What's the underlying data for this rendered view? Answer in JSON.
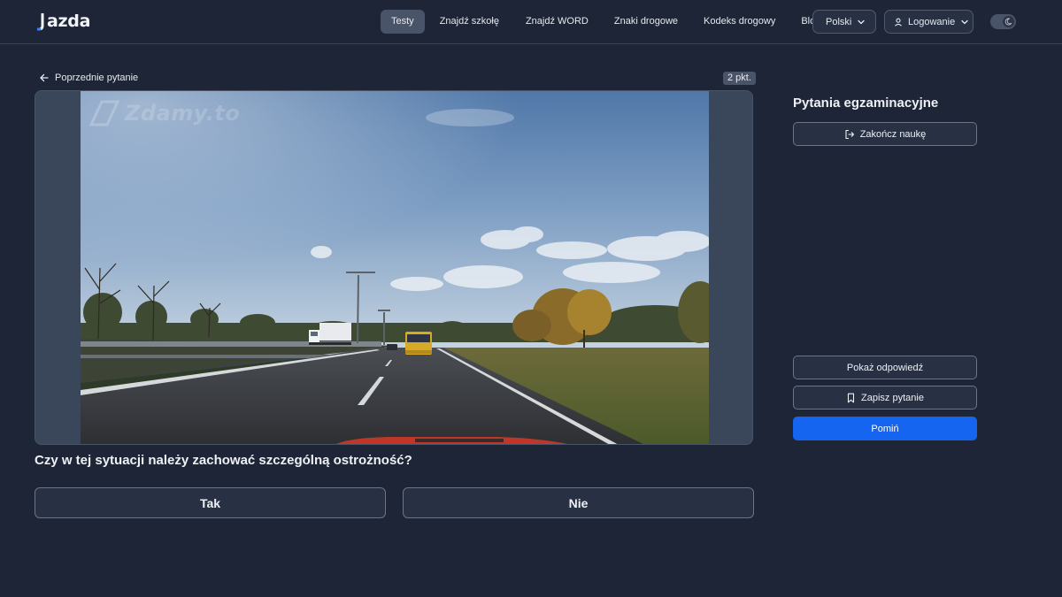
{
  "header": {
    "logo_text": "azda",
    "nav": [
      {
        "label": "Testy",
        "active": true
      },
      {
        "label": "Znajdź szkołę",
        "active": false
      },
      {
        "label": "Znajdź WORD",
        "active": false
      },
      {
        "label": "Znaki drogowe",
        "active": false
      },
      {
        "label": "Kodeks drogowy",
        "active": false
      },
      {
        "label": "Blog",
        "active": false
      }
    ],
    "language_label": "Polski",
    "login_label": "Logowanie",
    "theme_toggle_icon": "moon-icon"
  },
  "question": {
    "prev_label": "Poprzednie pytanie",
    "points_label": "2 pkt.",
    "media_watermark": "Zdamy.to",
    "text": "Czy w tej sytuacji należy zachować szczególną ostrożność?",
    "answers": {
      "yes": "Tak",
      "no": "Nie"
    }
  },
  "sidebar": {
    "title": "Pytania egzaminacyjne",
    "finish_label": "Zakończ naukę",
    "show_answer_label": "Pokaż odpowiedź",
    "save_label": "Zapisz pytanie",
    "skip_label": "Pomiń"
  },
  "colors": {
    "background": "#1e2537",
    "primary_button": "#1565f0",
    "active_nav": "#4a5468"
  },
  "icons": [
    "arrow-left-icon",
    "chevron-down-icon",
    "user-icon",
    "moon-icon",
    "logout-icon",
    "bookmark-icon"
  ]
}
